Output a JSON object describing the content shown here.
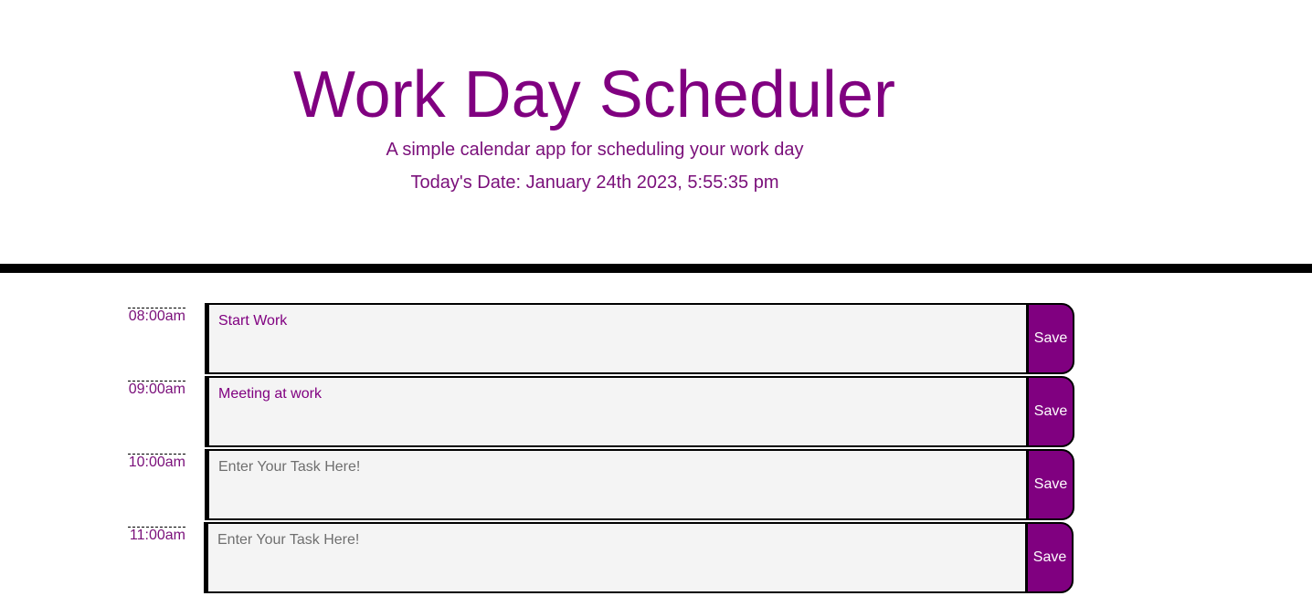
{
  "header": {
    "title": "Work Day Scheduler",
    "subtitle": "A simple calendar app for scheduling your work day",
    "date": "Today's Date: January 24th 2023, 5:55:35 pm"
  },
  "schedule": {
    "rows": [
      {
        "hour": "08:00am",
        "value": "Start Work",
        "placeholder": "Enter Your Task Here!",
        "save_label": "Save"
      },
      {
        "hour": "09:00am",
        "value": "Meeting at work",
        "placeholder": "Enter Your Task Here!",
        "save_label": "Save"
      },
      {
        "hour": "10:00am",
        "value": "",
        "placeholder": "Enter Your Task Here!",
        "save_label": "Save"
      },
      {
        "hour": "11:00am",
        "value": "",
        "placeholder": "Enter Your Task Here!",
        "save_label": "Save"
      }
    ]
  },
  "colors": {
    "accent": "#800080",
    "text_accent": "#7a0f7a",
    "divider": "#000000",
    "task_background": "#f4f4f4"
  }
}
